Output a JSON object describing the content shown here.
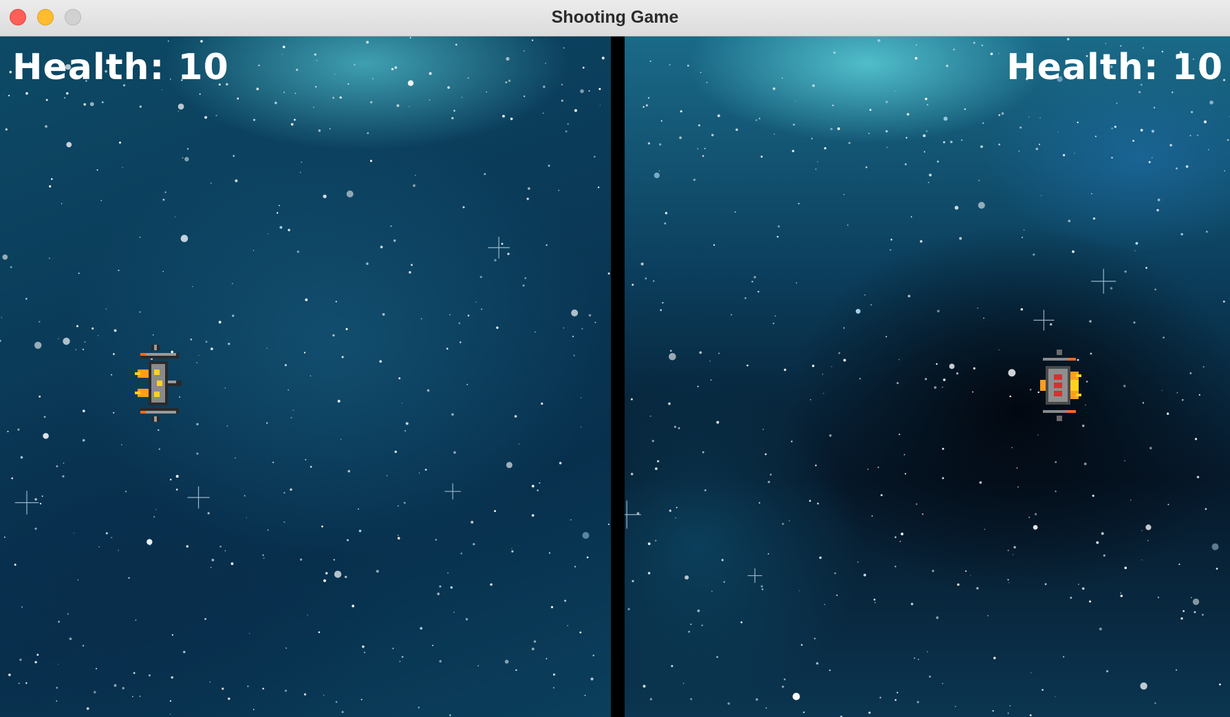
{
  "window": {
    "title": "Shooting Game"
  },
  "players": [
    {
      "health_label": "Health: 10",
      "health": 10,
      "ship_facing": "right"
    },
    {
      "health_label": "Health: 10",
      "health": 10,
      "ship_facing": "left"
    }
  ],
  "colors": {
    "space_dark": "#07304d",
    "nebula_cyan": "#5ac8d4",
    "divider": "#000000",
    "ship_hull": "#8a8a8a",
    "ship_flame": "#ff9f1a",
    "ship_accent": "#ffd21f"
  },
  "icons": {
    "close": "close-icon",
    "minimize": "minimize-icon",
    "zoom": "zoom-icon",
    "player_ship": "spaceship-icon"
  }
}
